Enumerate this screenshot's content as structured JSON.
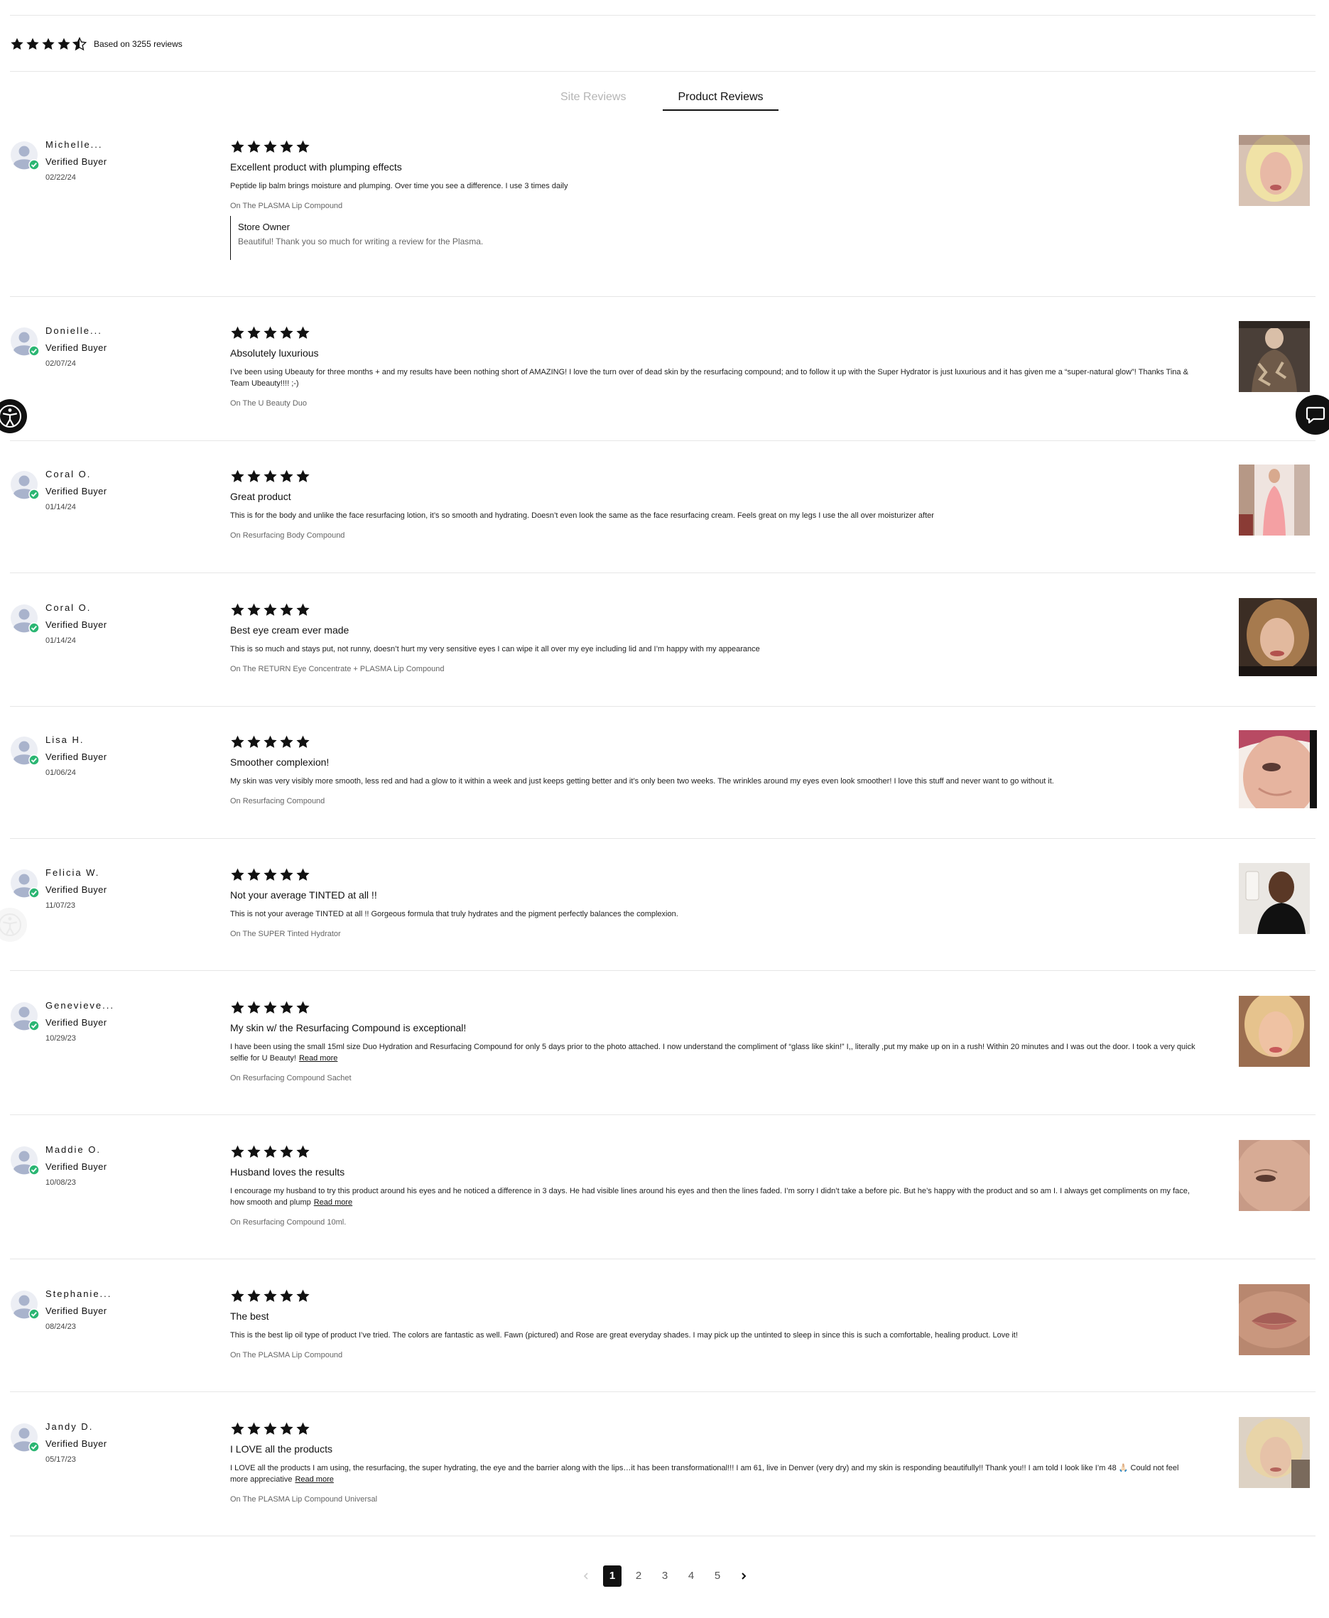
{
  "summary": {
    "rating": 4.5,
    "based_on": "Based on 3255 reviews"
  },
  "tabs": {
    "site": "Site Reviews",
    "product": "Product Reviews",
    "active": "Product Reviews"
  },
  "reviews": [
    {
      "name": "Michelle...",
      "badge": "Verified Buyer",
      "date": "02/22/24",
      "rating": 5,
      "title": "Excellent product with plumping effects",
      "body": "Peptide lip balm brings moisture and plumping. Over time you see a difference. I use 3 times daily",
      "read_more": "",
      "product": "On The PLASMA Lip Compound",
      "reply": {
        "author": "Store Owner",
        "text": "Beautiful! Thank you so much for writing a review for the Plasma."
      }
    },
    {
      "name": "Donielle...",
      "badge": "Verified Buyer",
      "date": "02/07/24",
      "rating": 5,
      "title": "Absolutely luxurious",
      "body": "I’ve been using Ubeauty for three months + and my results have been nothing short of AMAZING! I love the turn over of dead skin by the resurfacing compound; and to follow it up with the Super Hydrator is just luxurious and it has given me a “super-natural glow”! Thanks Tina & Team Ubeauty!!!! ;-)",
      "read_more": "",
      "product": "On The U Beauty Duo"
    },
    {
      "name": "Coral O.",
      "badge": "Verified Buyer",
      "date": "01/14/24",
      "rating": 5,
      "title": "Great product",
      "body": "This is for the body and unlike the face resurfacing lotion, it’s so smooth and hydrating. Doesn’t even look the same as the face resurfacing cream. Feels great on my legs I use the all over moisturizer after",
      "read_more": "",
      "product": "On Resurfacing Body Compound"
    },
    {
      "name": "Coral O.",
      "badge": "Verified Buyer",
      "date": "01/14/24",
      "rating": 5,
      "title": "Best eye cream ever made",
      "body": "This is so much and stays put, not runny, doesn’t hurt my very sensitive eyes I can wipe it all over my eye including lid and I’m happy with my appearance",
      "read_more": "",
      "product": "On The RETURN Eye Concentrate + PLASMA Lip Compound"
    },
    {
      "name": "Lisa H.",
      "badge": "Verified Buyer",
      "date": "01/06/24",
      "rating": 5,
      "title": "Smoother complexion!",
      "body": "My skin was very visibly more smooth, less red and had a glow to it within a week and just keeps getting better and it’s only been two weeks. The wrinkles around my eyes even look smoother! I love this stuff and never want to go without it.",
      "read_more": "",
      "product": "On Resurfacing Compound"
    },
    {
      "name": "Felicia W.",
      "badge": "Verified Buyer",
      "date": "11/07/23",
      "rating": 5,
      "title": "Not your average TINTED at all !!",
      "body": "This is not your average TINTED at all !! Gorgeous formula that truly hydrates and the pigment perfectly balances the complexion.",
      "read_more": "",
      "product": "On The SUPER Tinted Hydrator"
    },
    {
      "name": "Genevieve...",
      "badge": "Verified Buyer",
      "date": "10/29/23",
      "rating": 5,
      "title": "My skin w/ the Resurfacing Compound is exceptional!",
      "body": "I have been using the small 15ml size Duo Hydration and Resurfacing Compound for only 5 days prior to the photo attached. I now understand the compliment of “glass like skin!” I,, literally ,put my make up on in a rush! Within 20 minutes and I was out the door. I took a very quick selfie for U Beauty!",
      "read_more": "Read more",
      "product": "On Resurfacing Compound Sachet"
    },
    {
      "name": "Maddie O.",
      "badge": "Verified Buyer",
      "date": "10/08/23",
      "rating": 5,
      "title": "Husband loves the results",
      "body": "I encourage my husband to try this product around his eyes and he noticed a difference in 3 days. He had visible lines around his eyes and then the lines faded. I’m sorry I didn’t take a before pic. But he’s happy with the product and so am I. I always get compliments on my face, how smooth and plump",
      "read_more": "Read more",
      "product": "On Resurfacing Compound 10ml."
    },
    {
      "name": "Stephanie...",
      "badge": "Verified Buyer",
      "date": "08/24/23",
      "rating": 5,
      "title": "The best",
      "body": "This is the best lip oil type of product I’ve tried. The colors are fantastic as well. Fawn (pictured) and Rose are great everyday shades. I may pick up the untinted to sleep in since this is such a comfortable, healing product. Love it!",
      "read_more": "",
      "product": "On The PLASMA Lip Compound"
    },
    {
      "name": "Jandy D.",
      "badge": "Verified Buyer",
      "date": "05/17/23",
      "rating": 5,
      "title": "I LOVE all the products",
      "body": "I LOVE all the products I am using, the resurfacing, the super hydrating, the eye and the barrier along with the lips…it has been transformational!!! I am 61, live in Denver (very dry) and my skin is responding beautifully!! Thank you!! I am told I look like I’m 48 🙏🏻 Could not feel more appreciative",
      "read_more": "Read more",
      "product": "On The PLASMA Lip Compound Universal"
    }
  ],
  "pagination": {
    "pages": [
      "1",
      "2",
      "3",
      "4",
      "5"
    ],
    "current": "1"
  },
  "colors": {
    "text": "#111111",
    "muted": "#666666",
    "verified": "#2bb673",
    "avatar": "#a9b3cc",
    "tab_inactive": "#b5b5b5"
  }
}
